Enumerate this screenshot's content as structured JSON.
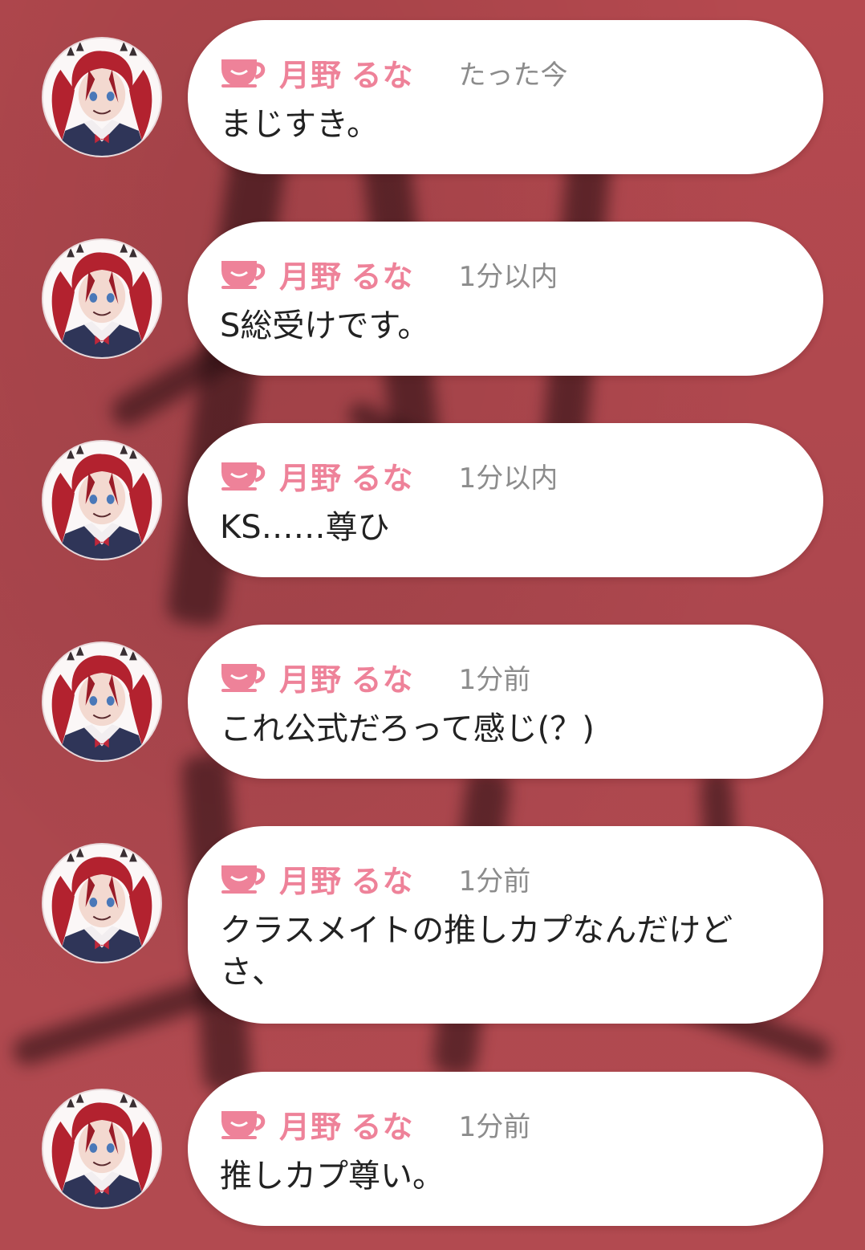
{
  "feed": {
    "messages": [
      {
        "author": "月野 るな",
        "time": "たった今",
        "text": "まじすき。"
      },
      {
        "author": "月野 るな",
        "time": "1分以内",
        "text": "S総受けです。"
      },
      {
        "author": "月野 るな",
        "time": "1分以内",
        "text": "KS……尊ひ"
      },
      {
        "author": "月野 るな",
        "time": "1分前",
        "text": "これ公式だろって感じ(？)"
      },
      {
        "author": "月野 るな",
        "time": "1分前",
        "text": "クラスメイトの推しカプなんだけどさ、"
      },
      {
        "author": "月野 るな",
        "time": "1分前",
        "text": "推しカプ尊い。"
      }
    ],
    "author_icon": "cup-icon",
    "avatar_icon": "avatar-red-hair-girl"
  },
  "colors": {
    "background": "#b04a52",
    "bubble": "#ffffff",
    "author": "#ee8299",
    "time": "#8c8c8c",
    "text": "#222222"
  }
}
